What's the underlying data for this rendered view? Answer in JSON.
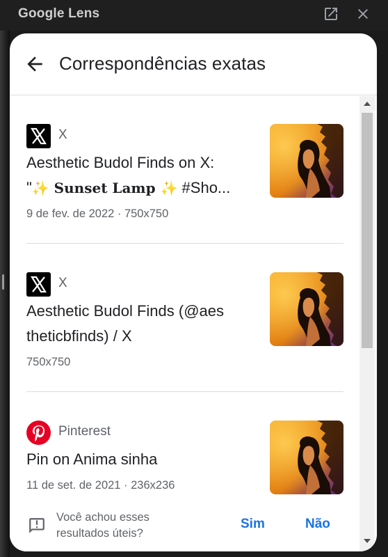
{
  "window": {
    "title": "Google Lens"
  },
  "header": {
    "title": "Correspondências exatas"
  },
  "results": [
    {
      "source": "X",
      "title_text": "Aesthetic Budol Finds on X:",
      "title_quote": "\"",
      "title_spark": "✨",
      "title_bold": " Sunset Lamp ",
      "title_tail": " #Sho...",
      "meta": "9 de fev. de 2022 · 750x750"
    },
    {
      "source": "X",
      "title_text": "Aesthetic Budol Finds (@aes theticbfinds) / X",
      "meta": "750x750"
    },
    {
      "source": "Pinterest",
      "title_text": "Pin on Anima sinha",
      "meta": "11 de set. de 2021 · 236x236"
    }
  ],
  "feedback": {
    "question": "Você achou esses resultados úteis?",
    "yes": "Sim",
    "no": "Não"
  },
  "colors": {
    "accent": "#1a73e8",
    "pinterest": "#e60023",
    "text": "#202124",
    "secondary": "#5f6368"
  }
}
